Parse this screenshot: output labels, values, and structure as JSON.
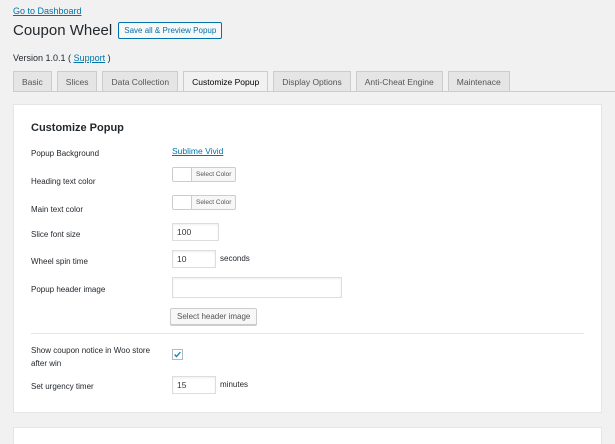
{
  "header": {
    "back_link": "Go to Dashboard",
    "title": "Coupon Wheel",
    "save_button": "Save all & Preview Popup",
    "version_prefix": "Version 1.0.1 (",
    "support_link": "Support",
    "version_suffix": ")"
  },
  "tabs": [
    {
      "label": "Basic",
      "active": false
    },
    {
      "label": "Slices",
      "active": false
    },
    {
      "label": "Data Collection",
      "active": false
    },
    {
      "label": "Customize Popup",
      "active": true
    },
    {
      "label": "Display Options",
      "active": false
    },
    {
      "label": "Anti-Cheat Engine",
      "active": false
    },
    {
      "label": "Maintenace",
      "active": false
    }
  ],
  "panel": {
    "title": "Customize Popup",
    "popup_background": {
      "label": "Popup Background",
      "value": "Sublime Vivid"
    },
    "heading_color": {
      "label": "Heading text color",
      "button": "Select Color",
      "swatch": "#ffffff"
    },
    "main_color": {
      "label": "Main text color",
      "button": "Select Color",
      "swatch": "#ffffff"
    },
    "slice_font_size": {
      "label": "Slice font size",
      "value": "100"
    },
    "wheel_spin_time": {
      "label": "Wheel spin time",
      "value": "10",
      "suffix": "seconds"
    },
    "header_image": {
      "label": "Popup header image",
      "value": "",
      "button": "Select header image"
    },
    "coupon_notice": {
      "label": "Show coupon notice in Woo store after win",
      "checked": true
    },
    "urgency_timer": {
      "label": "Set urgency timer",
      "value": "15",
      "suffix": "minutes"
    }
  },
  "colors": {
    "link": "#0073aa",
    "checkmark": "#1e8cbe"
  }
}
